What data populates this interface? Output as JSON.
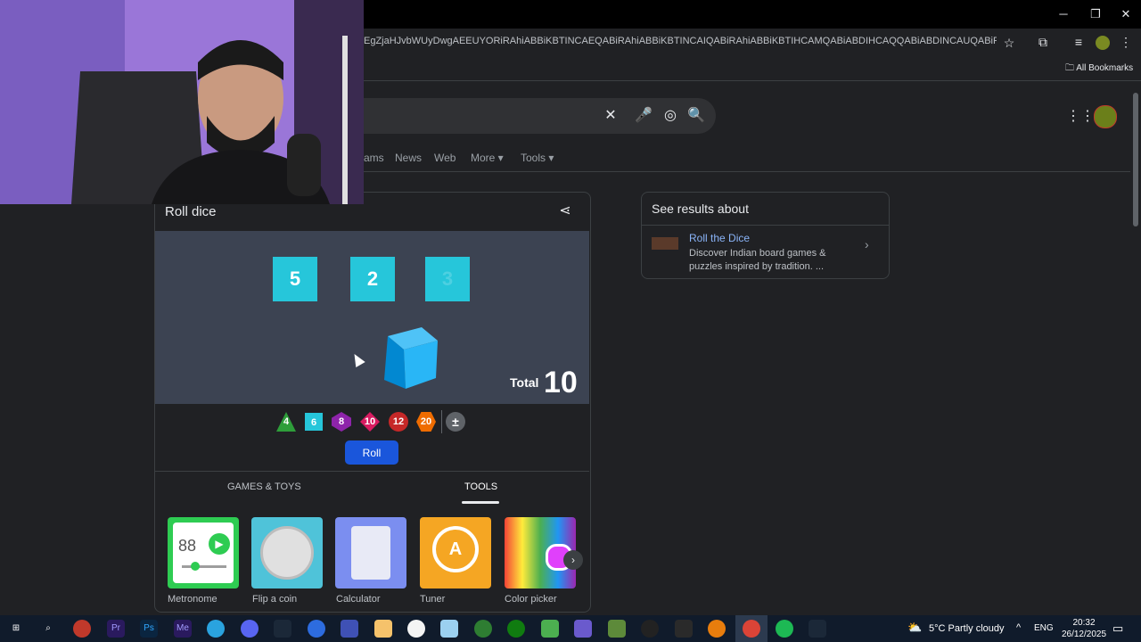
{
  "browser": {
    "url": "EgZjaHJvbWUyDwgAEEUYORiRAhiABBiKBTINCAEQABiRAhiABBiKBTINCAIQABiRAhiABBiKBTIHCAMQABiABDIHCAQQABiABDINCAUQABiRAhiABBiKBTIM...",
    "bookmarks_label": "All Bookmarks",
    "minimize_icon": "─",
    "restore_icon": "❐",
    "close_icon": "✕"
  },
  "search": {
    "clear_icon": "✕",
    "mic_icon": "🎤",
    "lens_icon": "◎",
    "search_icon": "🔍",
    "tabs": [
      "ams",
      "News",
      "Web",
      "More ▾",
      "Tools ▾"
    ]
  },
  "dice_card": {
    "title": "Roll dice",
    "dice": [
      "5",
      "2",
      "3"
    ],
    "total_label": "Total",
    "total_value": "10",
    "die_types": [
      "4",
      "6",
      "8",
      "10",
      "12",
      "20",
      "±"
    ],
    "roll_button": "Roll",
    "tab_games": "GAMES & TOYS",
    "tab_tools": "TOOLS",
    "tools": [
      "Metronome",
      "Flip a coin",
      "Calculator",
      "Tuner",
      "Color picker"
    ],
    "metronome_display": "88"
  },
  "side_panel": {
    "title": "See results about",
    "link": "Roll the Dice",
    "description": "Discover Indian board games & puzzles inspired by tradition. ..."
  },
  "taskbar": {
    "weather": "5°C  Partly cloudy",
    "language": "ENG",
    "time": "20:32",
    "date": "26/12/2025"
  }
}
